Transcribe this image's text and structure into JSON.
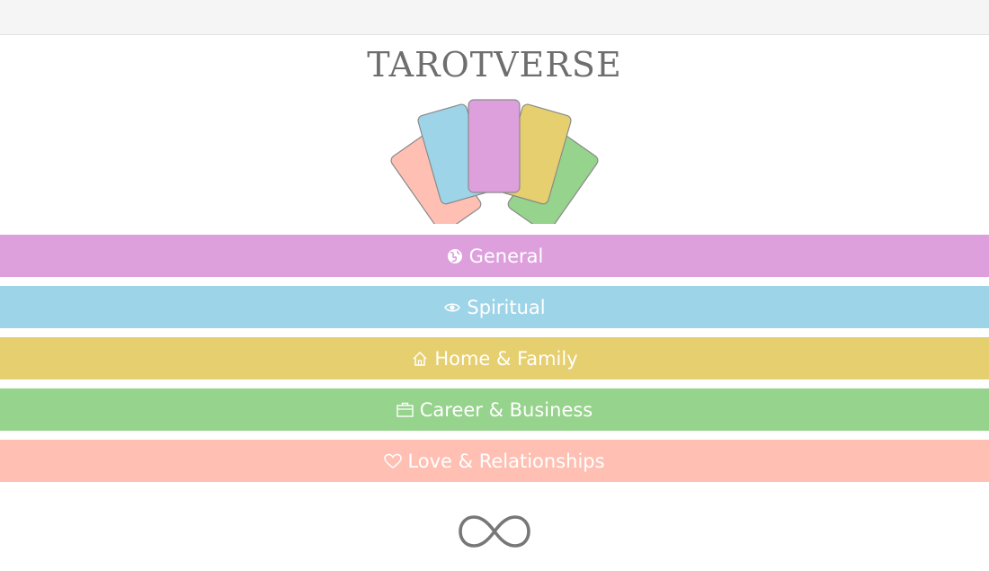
{
  "app": {
    "title": "TAROTVERSE"
  },
  "colors": {
    "general": "#dda0dd",
    "spiritual": "#9ed4e8",
    "home": "#e6cf6e",
    "career": "#96d38c",
    "love": "#ffc0b3"
  },
  "menu": {
    "items": [
      {
        "label": "General",
        "icon": "globe-icon"
      },
      {
        "label": "Spiritual",
        "icon": "eye-icon"
      },
      {
        "label": "Home & Family",
        "icon": "house-icon"
      },
      {
        "label": "Career & Business",
        "icon": "briefcase-icon"
      },
      {
        "label": "Love & Relationships",
        "icon": "heart-icon"
      }
    ]
  },
  "footer": {
    "icon": "infinity-icon"
  }
}
